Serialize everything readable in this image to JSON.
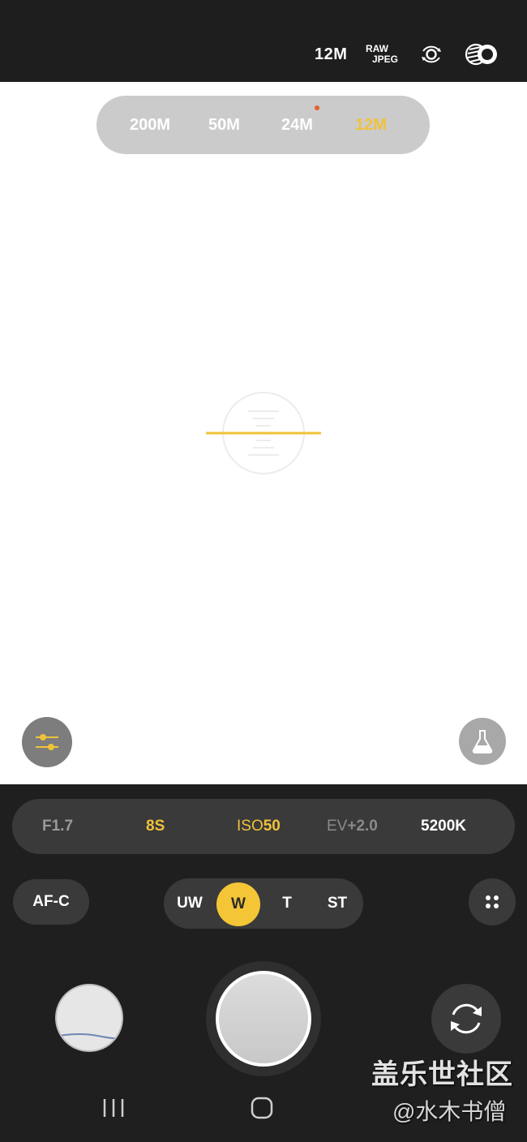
{
  "top_bar": {
    "resolution": "12M",
    "format_line1": "RAW",
    "format_line2": "JPEG",
    "lens_icon": "lens-switch-icon",
    "filter_icon": "filter-icon"
  },
  "resolution_selector": {
    "options": [
      "200M",
      "50M",
      "24M",
      "12M"
    ],
    "selected": "12M",
    "new_indicator_on": "24M"
  },
  "viewfinder": {
    "level_indicator": "level-icon",
    "left_button_icon": "adjust-sliders-icon",
    "right_button_icon": "lab-flask-icon"
  },
  "params": {
    "aperture": "F1.7",
    "shutter": "8S",
    "iso_key": "ISO",
    "iso_value": "50",
    "ev_key": "EV",
    "ev_value": "+2.0",
    "white_balance": "5200K"
  },
  "focus_mode": "AF-C",
  "lenses": {
    "options": [
      "UW",
      "W",
      "T",
      "ST"
    ],
    "selected": "W"
  },
  "colors": {
    "accent": "#f0c23a",
    "top_bar_bg": "#1e1e1e",
    "panel_bg": "#1f1f1f",
    "pill_bg": "#3a3a3a",
    "new_dot": "#e2622e"
  },
  "watermark": {
    "line1": "盖乐世社区",
    "line2": "@水木书僧"
  },
  "nav": {
    "recent_icon": "recent-apps-icon",
    "home_icon": "home-icon"
  }
}
